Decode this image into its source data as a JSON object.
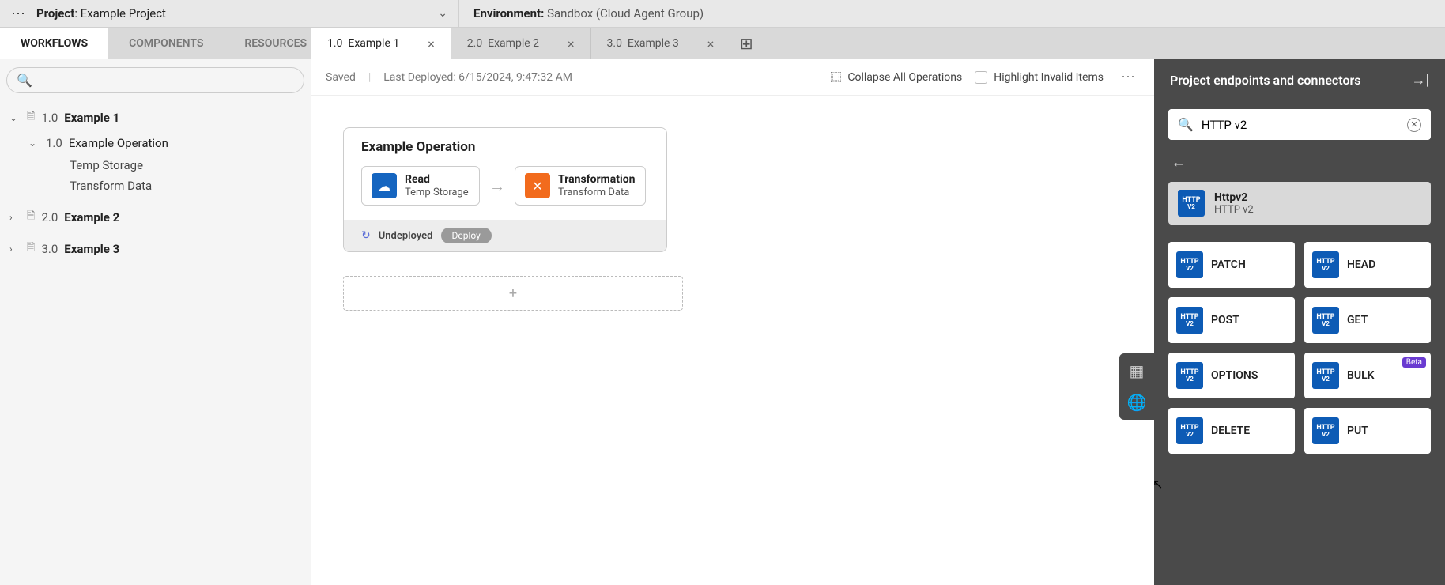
{
  "topbar": {
    "project_prefix": "Project",
    "project_name": "Example Project",
    "env_prefix": "Environment:",
    "env_name": "Sandbox (Cloud Agent Group)"
  },
  "navtabs": [
    {
      "label": "WORKFLOWS",
      "active": true
    },
    {
      "label": "COMPONENTS",
      "active": false
    },
    {
      "label": "RESOURCES",
      "active": false
    }
  ],
  "filetabs": [
    {
      "num": "1.0",
      "label": "Example 1",
      "active": true
    },
    {
      "num": "2.0",
      "label": "Example 2",
      "active": false
    },
    {
      "num": "3.0",
      "label": "Example 3",
      "active": false
    }
  ],
  "sidebar": {
    "search_placeholder": "",
    "tree": [
      {
        "num": "1.0",
        "name": "Example 1",
        "expanded": true,
        "children": [
          {
            "num": "1.0",
            "name": "Example Operation",
            "expanded": true,
            "leaves": [
              "Temp Storage",
              "Transform Data"
            ]
          }
        ]
      },
      {
        "num": "2.0",
        "name": "Example 2",
        "expanded": false
      },
      {
        "num": "3.0",
        "name": "Example 3",
        "expanded": false
      }
    ]
  },
  "canvas": {
    "saved": "Saved",
    "deployed": "Last Deployed: 6/15/2024, 9:47:32 AM",
    "collapse": "Collapse All Operations",
    "highlight": "Highlight Invalid Items",
    "operation": {
      "title": "Example Operation",
      "node1": {
        "title": "Read",
        "sub": "Temp Storage"
      },
      "node2": {
        "title": "Transformation",
        "sub": "Transform Data"
      },
      "status": "Undeployed",
      "deploy_btn": "Deploy"
    }
  },
  "rpanel": {
    "title": "Project endpoints and connectors",
    "search_value": "HTTP v2",
    "selected": {
      "name": "Httpv2",
      "sub": "HTTP v2"
    },
    "items": [
      {
        "label": "PATCH"
      },
      {
        "label": "HEAD"
      },
      {
        "label": "POST"
      },
      {
        "label": "GET"
      },
      {
        "label": "OPTIONS"
      },
      {
        "label": "BULK",
        "beta": "Beta"
      },
      {
        "label": "DELETE"
      },
      {
        "label": "PUT"
      }
    ]
  }
}
